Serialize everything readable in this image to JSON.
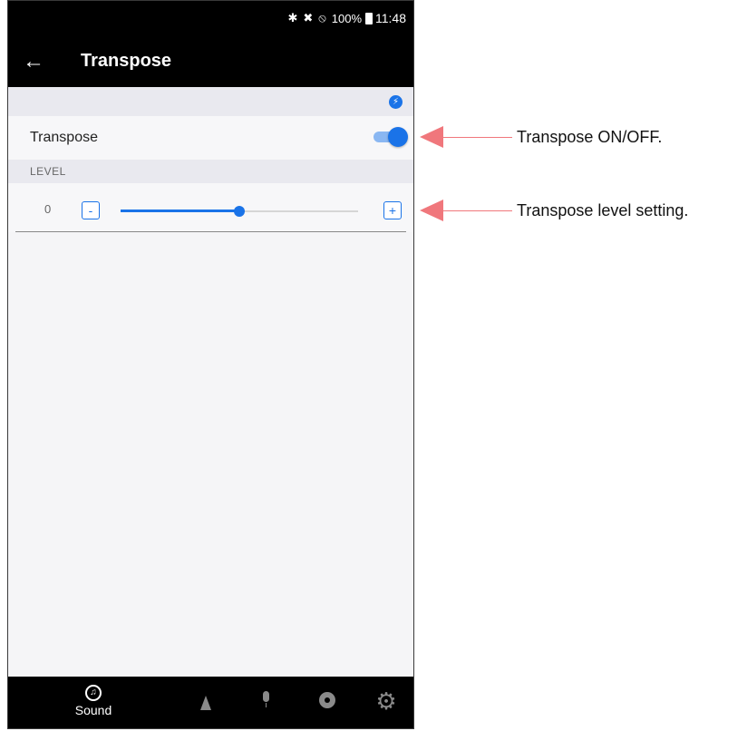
{
  "status_bar": {
    "icons": [
      "bluetooth-icon",
      "vibrate-mute-icon",
      "do-not-disturb-icon"
    ],
    "battery": "100%",
    "time": "11:48"
  },
  "app_bar": {
    "title": "Transpose",
    "back_icon": "arrow-left-icon"
  },
  "transpose_row": {
    "label": "Transpose",
    "toggle_on": true
  },
  "level_section": {
    "header": "LEVEL",
    "value": "0",
    "minus_label": "-",
    "plus_label": "+",
    "slider_fraction": 0.5
  },
  "bottom_nav": {
    "items": [
      {
        "icon": "music-note-icon",
        "label": "Sound"
      },
      {
        "icon": "metronome-icon",
        "label": ""
      },
      {
        "icon": "microphone-icon",
        "label": ""
      },
      {
        "icon": "disc-icon",
        "label": ""
      },
      {
        "icon": "gear-icon",
        "label": ""
      }
    ]
  },
  "callouts": [
    {
      "text": "Transpose ON/OFF."
    },
    {
      "text": "Transpose level setting."
    }
  ],
  "colors": {
    "accent": "#1a73e8",
    "callout": "#f0777c",
    "bar": "#000000"
  }
}
